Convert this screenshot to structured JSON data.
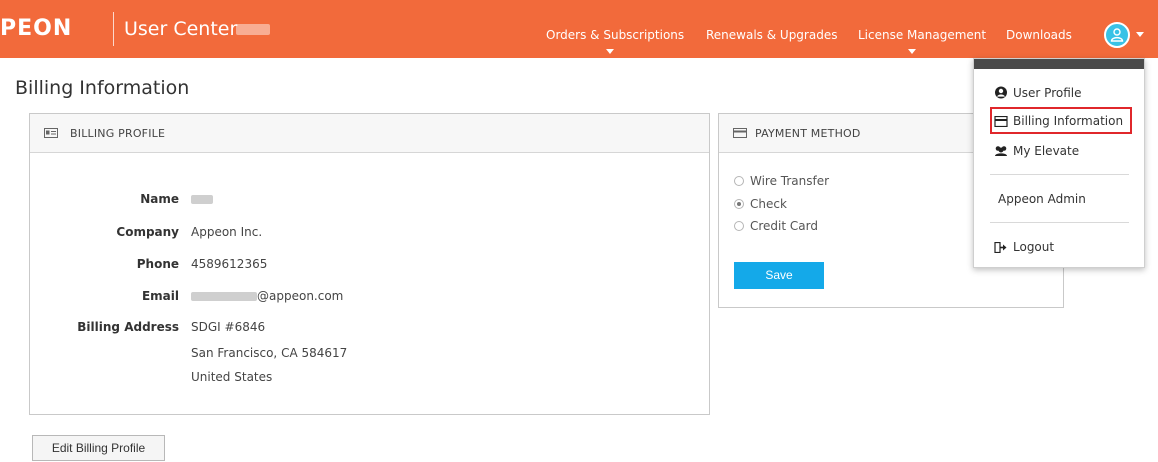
{
  "header": {
    "logo_text": "PEON",
    "app_title": "User Center",
    "nav": [
      {
        "label": "Orders & Subscriptions",
        "has_caret": true
      },
      {
        "label": "Renewals & Upgrades",
        "has_caret": false
      },
      {
        "label": "License Management",
        "has_caret": true
      },
      {
        "label": "Downloads",
        "has_caret": false
      }
    ],
    "avatar_icon": "user-icon",
    "brand_color": "#f26a3b",
    "avatar_color": "#39c2e6"
  },
  "page": {
    "title": "Billing Information"
  },
  "billing_profile": {
    "heading": "BILLING PROFILE",
    "icon": "id-card-icon",
    "fields": {
      "name_label": "Name",
      "company_label": "Company",
      "company_value": "Appeon Inc.",
      "phone_label": "Phone",
      "phone_value": "4589612365",
      "email_label": "Email",
      "email_domain": "@appeon.com",
      "address_label": "Billing Address",
      "address_line1": "SDGI #6846",
      "address_line2": "San Francisco, CA 584617",
      "address_line3": "United States"
    }
  },
  "payment_method": {
    "heading": "PAYMENT METHOD",
    "icon": "credit-card-icon",
    "options": [
      {
        "label": "Wire Transfer",
        "checked": false
      },
      {
        "label": "Check",
        "checked": true
      },
      {
        "label": "Credit Card",
        "checked": false
      }
    ],
    "save_label": "Save",
    "save_color": "#14a9e9"
  },
  "edit_button_label": "Edit Billing Profile",
  "dropdown": {
    "items": [
      {
        "label": "User Profile",
        "icon": "user-circle-icon"
      },
      {
        "label": "Billing Information",
        "icon": "credit-card-icon",
        "highlighted": true
      },
      {
        "label": "My Elevate",
        "icon": "users-icon"
      },
      {
        "label": "Appeon Admin",
        "icon": ""
      },
      {
        "label": "Logout",
        "icon": "sign-out-icon"
      }
    ],
    "highlight_color": "#e0272b"
  }
}
